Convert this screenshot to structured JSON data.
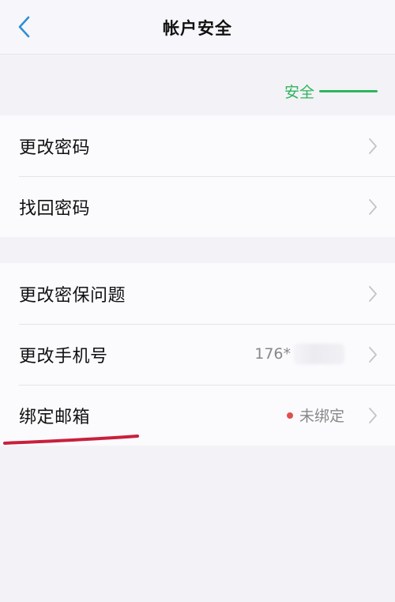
{
  "header": {
    "title": "帐户安全"
  },
  "security": {
    "level_text": "安全",
    "color": "#2db55d"
  },
  "groups": [
    {
      "items": [
        {
          "label": "更改密码"
        },
        {
          "label": "找回密码"
        }
      ]
    },
    {
      "items": [
        {
          "label": "更改密保问题"
        },
        {
          "label": "更改手机号",
          "value": "176*"
        },
        {
          "label": "绑定邮箱",
          "value": "未绑定",
          "status_color": "#e05050"
        }
      ]
    }
  ],
  "annotation": {
    "underline_color": "#c8203c"
  }
}
